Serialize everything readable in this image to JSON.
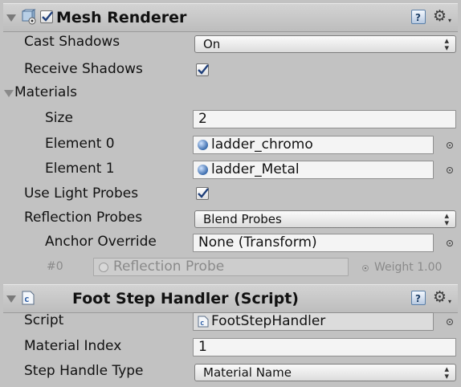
{
  "mesh_renderer": {
    "title": "Mesh Renderer",
    "enabled": true,
    "cast_shadows": {
      "label": "Cast Shadows",
      "value": "On"
    },
    "receive_shadows": {
      "label": "Receive Shadows",
      "checked": true
    },
    "materials": {
      "label": "Materials",
      "size_label": "Size",
      "size_value": "2",
      "elements": [
        {
          "label": "Element 0",
          "value": "ladder_chromo"
        },
        {
          "label": "Element 1",
          "value": "ladder_Metal"
        }
      ]
    },
    "use_light_probes": {
      "label": "Use Light Probes",
      "checked": true
    },
    "reflection_probes": {
      "label": "Reflection Probes",
      "value": "Blend Probes"
    },
    "anchor_override": {
      "label": "Anchor Override",
      "value": "None (Transform)"
    },
    "probe_row": {
      "index": "#0",
      "value": "Reflection Probe",
      "weight": "Weight 1.00"
    }
  },
  "foot_step_handler": {
    "title": "Foot Step Handler (Script)",
    "script": {
      "label": "Script",
      "value": "FootStepHandler"
    },
    "material_index": {
      "label": "Material Index",
      "value": "1"
    },
    "step_handle_type": {
      "label": "Step Handle Type",
      "value": "Material Name"
    }
  },
  "colors": {
    "background": "#c2c2c2",
    "header": "#c9c9c9",
    "sphere": "#4a7fc1"
  },
  "icons": [
    "fold-arrow-icon",
    "mesh-renderer-icon",
    "checkbox-icon",
    "help-book-icon",
    "gear-icon",
    "material-sphere-icon",
    "object-picker-icon",
    "script-icon",
    "dropdown-arrow-icon"
  ]
}
